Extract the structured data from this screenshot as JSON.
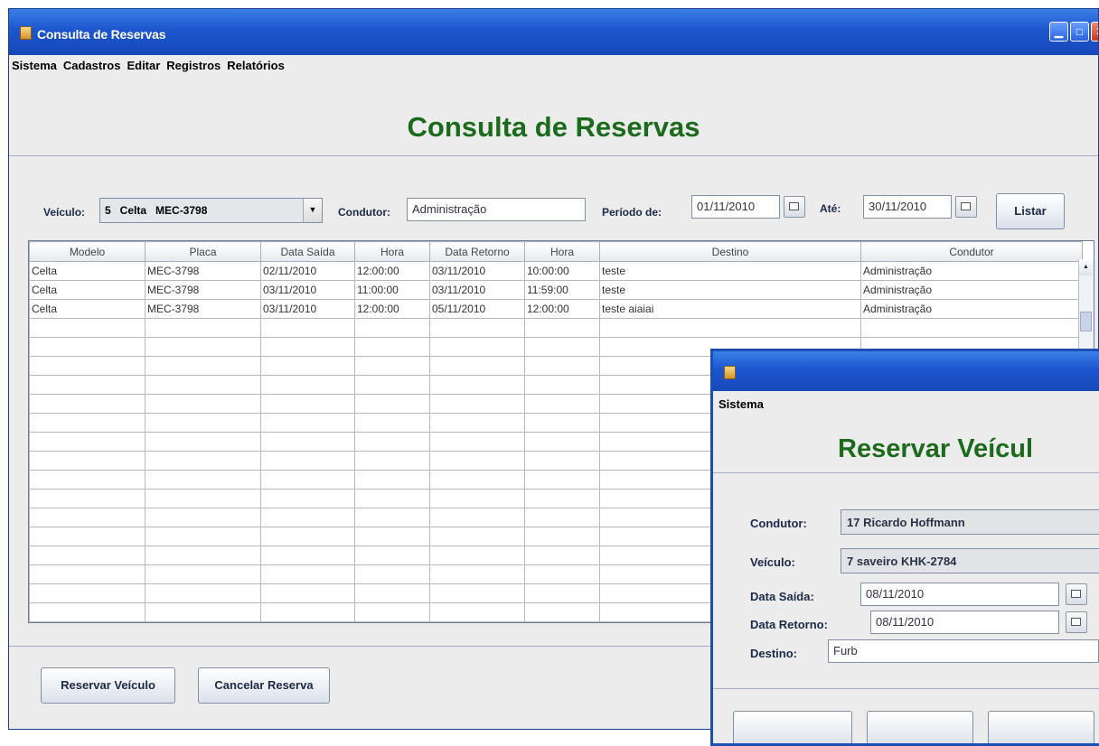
{
  "main_window": {
    "title": "Consulta de Reservas",
    "menu": [
      "Sistema",
      "Cadastros",
      "Editar",
      "Registros",
      "Relatórios"
    ],
    "heading": "Consulta de Reservas",
    "filters": {
      "veiculo_label": "Veículo:",
      "veiculo_value": "5   Celta   MEC-3798",
      "condutor_label": "Condutor:",
      "condutor_value": "Administração",
      "periodo_label": "Período de:",
      "periodo_from": "01/11/2010",
      "ate_label": "Até:",
      "periodo_to": "30/11/2010",
      "listar_button": "Listar"
    },
    "table": {
      "columns": [
        "Modelo",
        "Placa",
        "Data Saída",
        "Hora",
        "Data Retorno",
        "Hora",
        "Destino",
        "Condutor"
      ],
      "rows": [
        [
          "Celta",
          "MEC-3798",
          "02/11/2010",
          "12:00:00",
          "03/11/2010",
          "10:00:00",
          "teste",
          "Administração"
        ],
        [
          "Celta",
          "MEC-3798",
          "03/11/2010",
          "11:00:00",
          "03/11/2010",
          "11:59:00",
          "teste",
          "Administração"
        ],
        [
          "Celta",
          "MEC-3798",
          "03/11/2010",
          "12:00:00",
          "05/11/2010",
          "12:00:00",
          "teste aiaiai",
          "Administração"
        ]
      ]
    },
    "buttons": {
      "reservar": "Reservar Veículo",
      "cancelar": "Cancelar Reserva"
    }
  },
  "reserve_window": {
    "menu": [
      "Sistema"
    ],
    "heading": "Reservar Veícul",
    "condutor_label": "Condutor:",
    "condutor_value": "17    Ricardo Hoffmann",
    "veiculo_label": "Veículo:",
    "veiculo_value": "7    saveiro    KHK-2784",
    "data_saida_label": "Data Saída:",
    "data_saida_value": "08/11/2010",
    "data_retorno_label": "Data Retorno:",
    "data_retorno_value": "08/11/2010",
    "destino_label": "Destino:",
    "destino_value": "Furb"
  }
}
